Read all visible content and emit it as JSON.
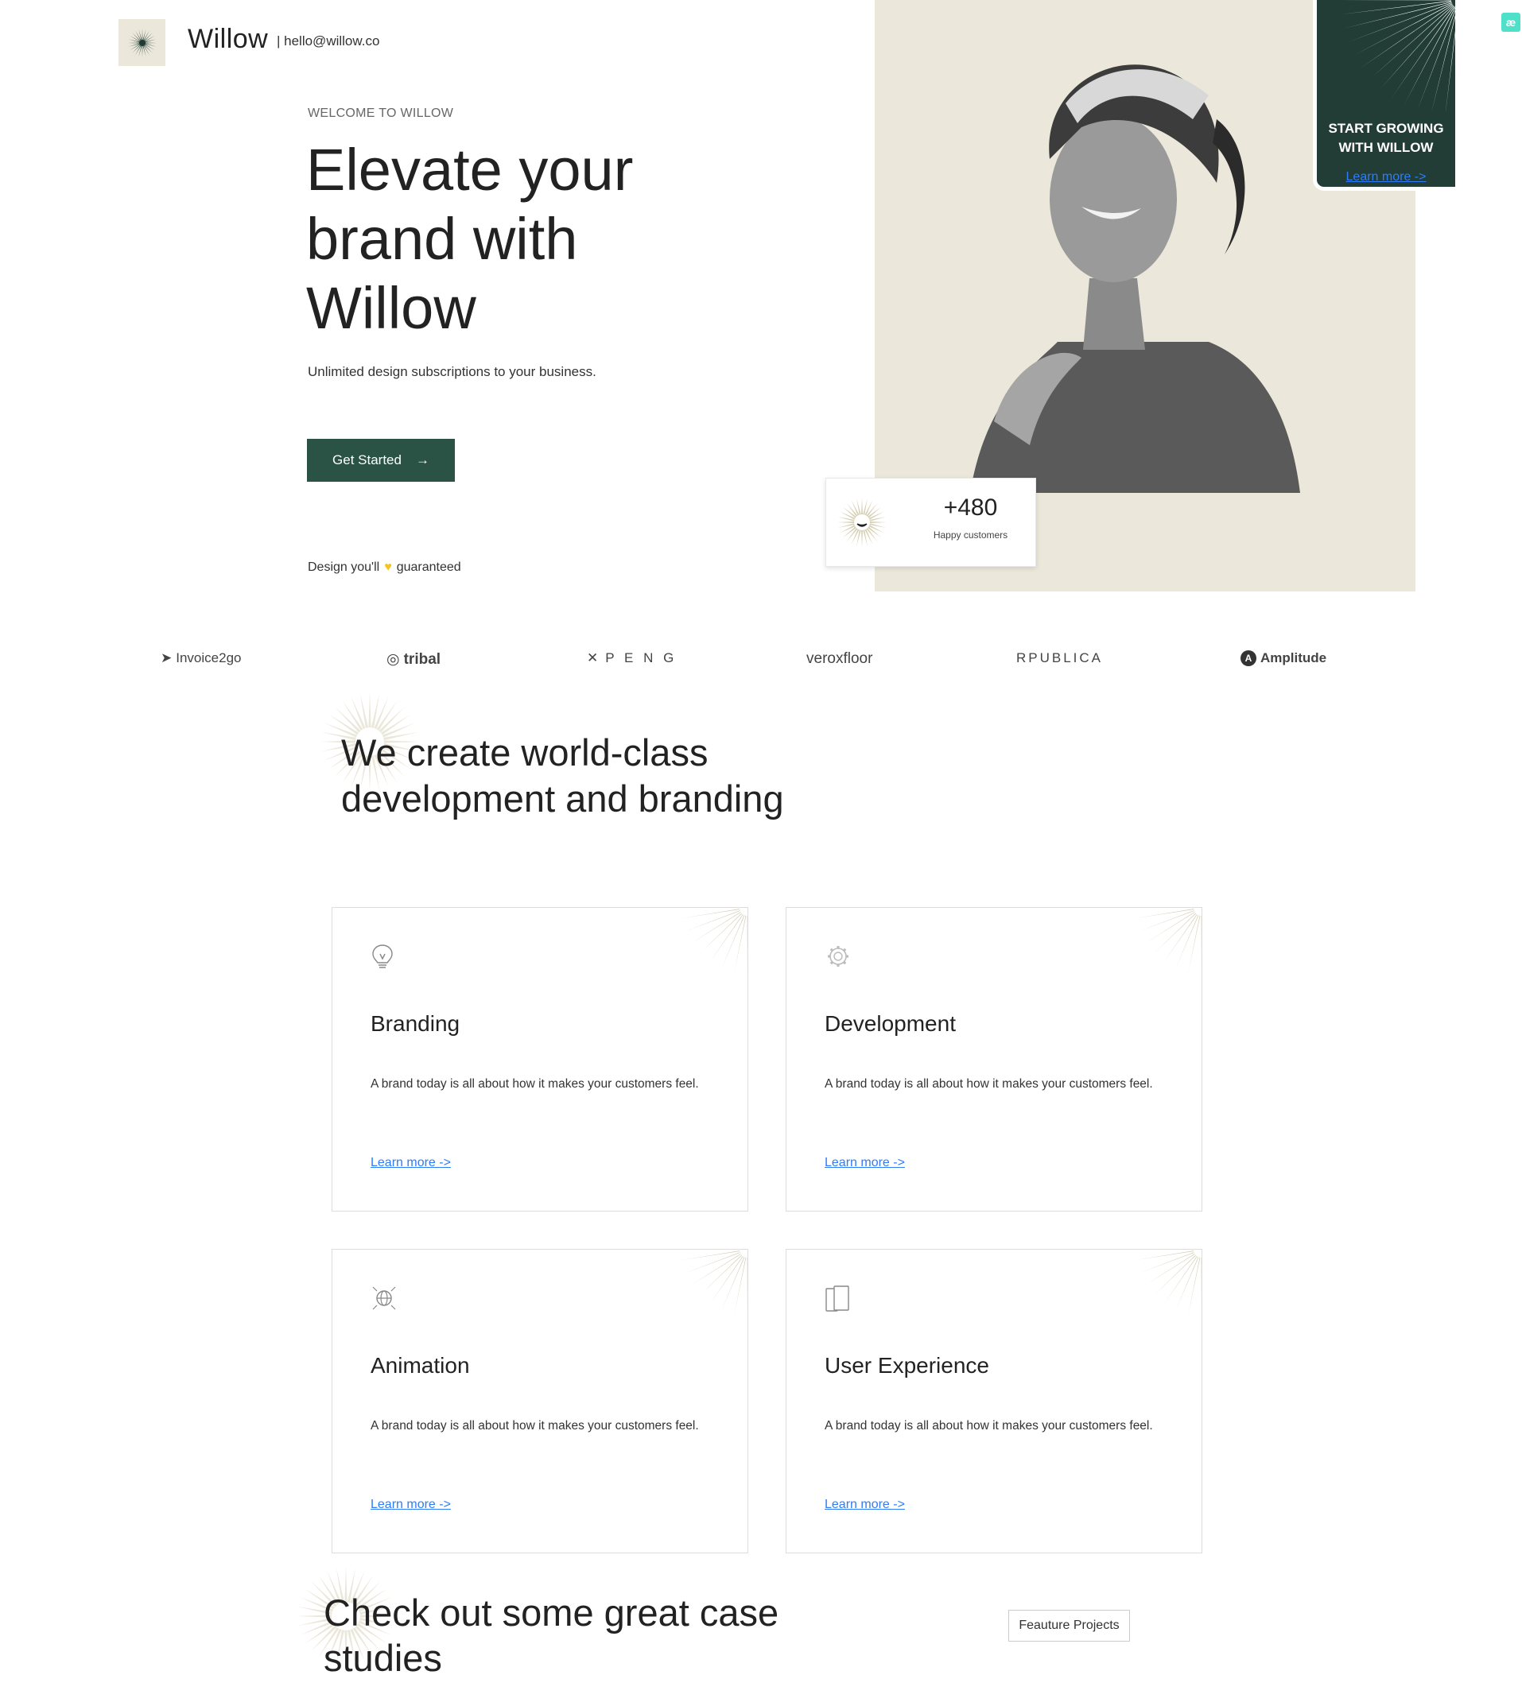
{
  "header": {
    "brand_name": "Willow",
    "email": "| hello@willow.co"
  },
  "hero": {
    "eyebrow": "WELCOME TO WILLOW",
    "title": "Elevate your brand with Willow",
    "subtitle": "Unlimited design subscriptions to your business.",
    "cta_label": "Get Started",
    "tagline_before": "Design you'll",
    "tagline_after": "guaranteed"
  },
  "promo": {
    "line1": "START GROWING",
    "line2": "WITH WILLOW",
    "link": "Learn more ->"
  },
  "stat": {
    "value": "+480",
    "label": "Happy customers"
  },
  "partners": [
    "Invoice2go",
    "tribal",
    "P E N G",
    "veroxfloor",
    "RPUBLICA",
    "Amplitude"
  ],
  "services": {
    "title": "We create world-class development and branding",
    "cards": [
      {
        "title": "Branding",
        "text": "A brand today is all about how it makes your customers feel.",
        "link": "Learn more ->",
        "icon": "lightbulb-icon"
      },
      {
        "title": "Development",
        "text": "A brand today is all about how it makes your customers feel.",
        "link": "Learn more ->",
        "icon": "gear-icon"
      },
      {
        "title": "Animation",
        "text": "A brand today is all about how it makes your customers feel.",
        "link": "Learn more ->",
        "icon": "globe-icon"
      },
      {
        "title": "User Experience",
        "text": "A brand today is all about how it makes your customers feel.",
        "link": "Learn more ->",
        "icon": "devices-icon"
      }
    ]
  },
  "cases": {
    "title": "Check out some great case studies",
    "button": "Feauture Projects"
  },
  "colors": {
    "accent": "#2a5245",
    "dark_green": "#213d35",
    "beige": "#ebe7da",
    "link": "#2f7cf6"
  }
}
